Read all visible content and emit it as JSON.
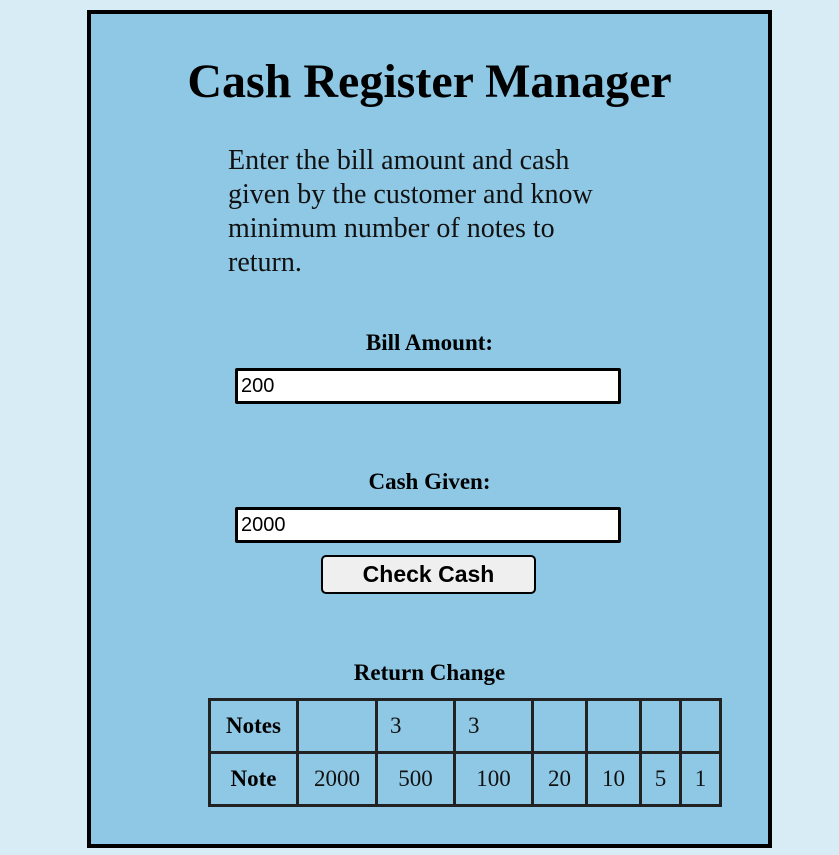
{
  "header": {
    "title": "Cash Register Manager",
    "description": "Enter the bill amount and cash given by the customer and know minimum number of notes to return."
  },
  "form": {
    "bill_label": "Bill Amount:",
    "bill_value": "200",
    "cash_label": "Cash Given:",
    "cash_value": "2000",
    "check_button": "Check Cash"
  },
  "result": {
    "title": "Return Change",
    "notes_header": "Notes",
    "note_header": "Note",
    "counts": [
      "",
      "3",
      "3",
      "",
      "",
      "",
      ""
    ],
    "denominations": [
      "2000",
      "500",
      "100",
      "20",
      "10",
      "5",
      "1"
    ]
  }
}
